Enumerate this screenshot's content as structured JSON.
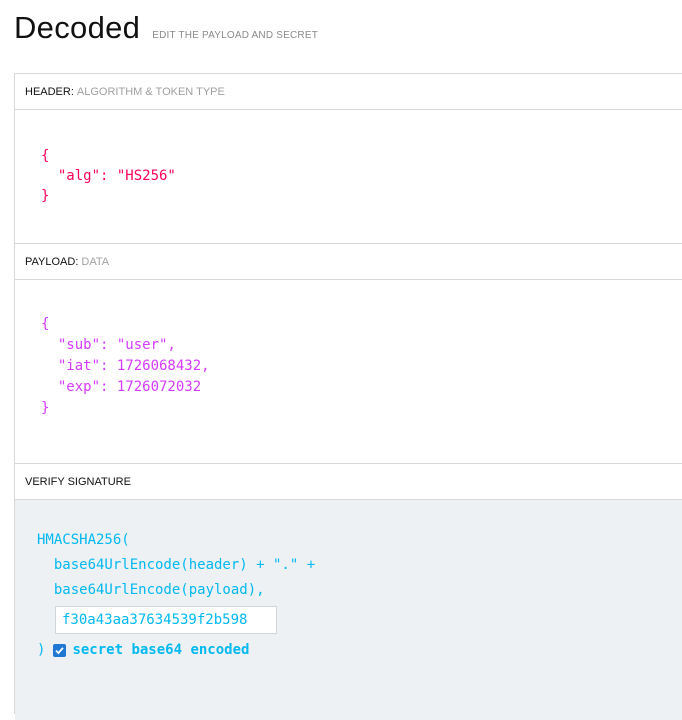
{
  "title": "Decoded",
  "subtitle": "EDIT THE PAYLOAD AND SECRET",
  "header_section": {
    "label": "HEADER:",
    "label_muted": "ALGORITHM & TOKEN TYPE",
    "lines": [
      "{",
      "  \"alg\": \"HS256\"",
      "}"
    ]
  },
  "payload_section": {
    "label": "PAYLOAD:",
    "label_muted": "DATA",
    "lines": [
      "{",
      "  \"sub\": \"user\",",
      "  \"iat\": 1726068432,",
      "  \"exp\": 1726072032",
      "}"
    ]
  },
  "verify_section": {
    "label": "VERIFY SIGNATURE",
    "func": "HMACSHA256(",
    "line1": "  base64UrlEncode(header) + \".\" +",
    "line2": "  base64UrlEncode(payload),",
    "secret_value": "f30a43aa37634539f2b598",
    "close": ")",
    "checkbox_label": "secret base64 encoded",
    "checkbox_checked": true
  },
  "colors": {
    "header_code": "#fb015b",
    "payload_code": "#d63aff",
    "verify_code": "#00b9f1",
    "checkbox": "#1f78d1"
  }
}
